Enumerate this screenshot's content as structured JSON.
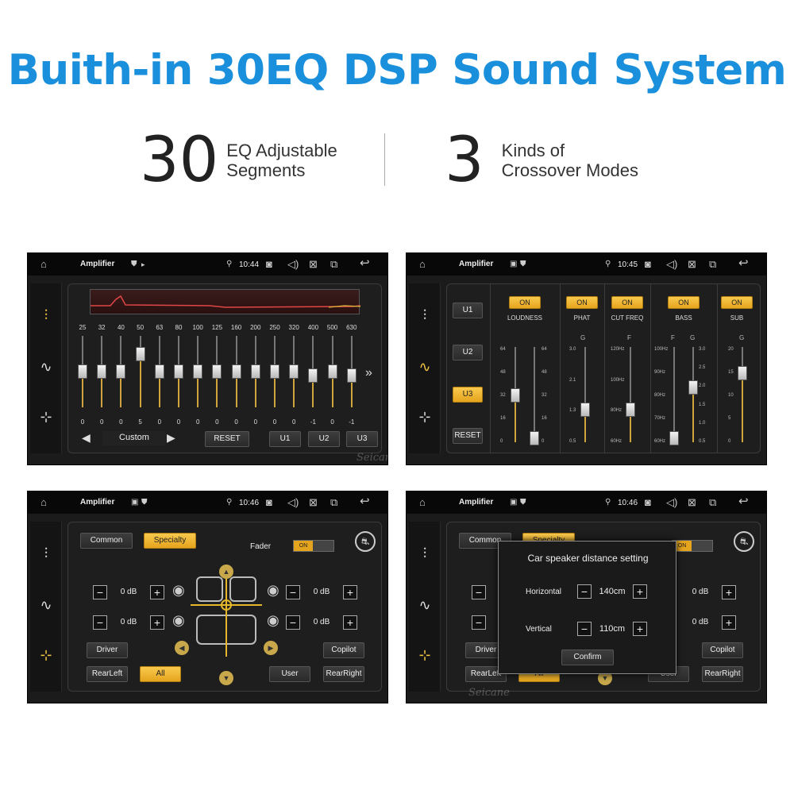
{
  "headline": "Buith-in 30EQ DSP Sound System",
  "stats": [
    {
      "number": "30",
      "line1": "EQ Adjustable",
      "line2": "Segments"
    },
    {
      "number": "3",
      "line1": "Kinds of",
      "line2": "Crossover Modes"
    }
  ],
  "colors": {
    "accent": "#f4c542",
    "headline": "#1a8fdb",
    "screen_bg": "#1b1b1b"
  },
  "watermark": "Seicane",
  "screens": [
    {
      "title": "Amplifier",
      "time": "10:44",
      "eq": {
        "freqs": [
          "25",
          "32",
          "40",
          "50",
          "63",
          "80",
          "100",
          "125",
          "160",
          "200",
          "250",
          "320",
          "400",
          "500",
          "630"
        ],
        "values": [
          "0",
          "0",
          "0",
          "5",
          "0",
          "0",
          "0",
          "0",
          "0",
          "0",
          "0",
          "0",
          "-1",
          "0",
          "-1"
        ],
        "level": [
          0,
          0,
          0,
          5,
          0,
          0,
          0,
          0,
          0,
          0,
          0,
          0,
          -1,
          0,
          -1
        ],
        "range": [
          -10,
          10
        ]
      },
      "preset": "Custom",
      "reset": "RESET",
      "u1": "U1",
      "u2": "U2",
      "u3": "U3"
    },
    {
      "title": "Amplifier",
      "time": "10:45",
      "u1": "U1",
      "u2": "U2",
      "u3": "U3",
      "reset": "RESET",
      "on": "ON",
      "cols": [
        {
          "name": "LOUDNESS"
        },
        {
          "name": "PHAT",
          "g": "G",
          "ticks": [
            "3.0",
            "2.1",
            "1.3",
            "0.5"
          ]
        },
        {
          "name": "CUT FREQ",
          "g": "F",
          "ticks": [
            "120Hz",
            "100Hz",
            "80Hz",
            "60Hz"
          ]
        },
        {
          "name": "BASS",
          "f": "F",
          "g": "G",
          "fticks": [
            "100Hz",
            "90Hz",
            "80Hz",
            "70Hz",
            "60Hz"
          ],
          "gticks": [
            "3.0",
            "2.5",
            "2.0",
            "1.5",
            "1.0",
            "0.5"
          ]
        },
        {
          "name": "SUB",
          "g": "G",
          "ticks": [
            "20",
            "15",
            "10",
            "5",
            "0"
          ]
        }
      ],
      "loud_ticks": [
        "64",
        "48",
        "32",
        "16",
        "0"
      ]
    },
    {
      "title": "Amplifier",
      "time": "10:46",
      "common": "Common",
      "specialty": "Specialty",
      "fader": "Fader",
      "on": "ON",
      "db": [
        "0 dB",
        "0 dB",
        "0 dB",
        "0 dB"
      ],
      "driver": "Driver",
      "copilot": "Copilot",
      "rearleft": "RearLeft",
      "all": "All",
      "user": "User",
      "rearright": "RearRight"
    },
    {
      "title": "Amplifier",
      "time": "10:46",
      "common": "Common",
      "specialty": "Specialty",
      "on": "ON",
      "db": [
        "0 dB",
        "0 dB"
      ],
      "driver": "Driver",
      "copilot": "Copilot",
      "rearleft": "RearLeft",
      "all": "All",
      "user": "User",
      "rearright": "RearRight",
      "dialog": {
        "title": "Car speaker distance setting",
        "h_label": "Horizontal",
        "h_value": "140cm",
        "v_label": "Vertical",
        "v_value": "110cm",
        "confirm": "Confirm"
      }
    }
  ]
}
